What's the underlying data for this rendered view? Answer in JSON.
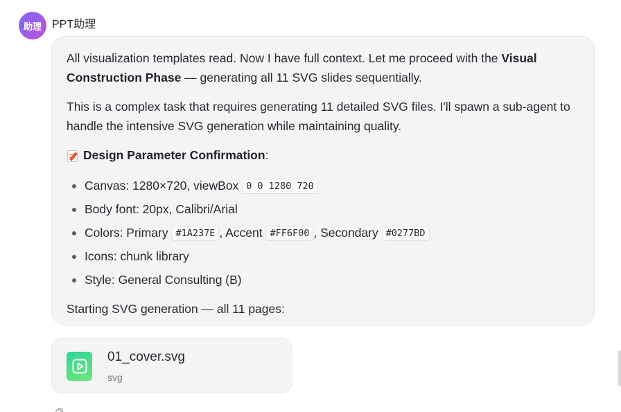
{
  "sender": {
    "avatar_text": "助理",
    "name": "PPT助理"
  },
  "message": {
    "para1_prefix": "All visualization templates read. Now I have full context. Let me proceed with the ",
    "para1_bold": "Visual Construction Phase",
    "para1_suffix": " — generating all 11 SVG slides sequentially.",
    "para2": "This is a complex task that requires generating 11 detailed SVG files. I'll spawn a sub-agent to handle the intensive SVG generation while maintaining quality.",
    "design_heading": "Design Parameter Confirmation",
    "design_colon": ":",
    "params": {
      "canvas_label": "Canvas: 1280×720, viewBox ",
      "canvas_code": "0 0 1280 720",
      "font": "Body font: 20px, Calibri/Arial",
      "colors_label": "Colors: Primary ",
      "primary_code": "#1A237E",
      "accent_label": ", Accent ",
      "accent_code": "#FF6F00",
      "secondary_label": ", Secondary ",
      "secondary_code": "#0277BD",
      "icons": "Icons: chunk library",
      "style": "Style: General Consulting (B)"
    },
    "final": "Starting SVG generation — all 11 pages:"
  },
  "attachment": {
    "file_name": "01_cover.svg",
    "file_type": "svg",
    "icon": "play-file-icon",
    "icon_color": "#3ED88E"
  },
  "colors": {
    "avatar_gradient_start": "#7B6CF6",
    "avatar_gradient_end": "#C04FD8",
    "bubble_bg": "#F4F4F5"
  }
}
